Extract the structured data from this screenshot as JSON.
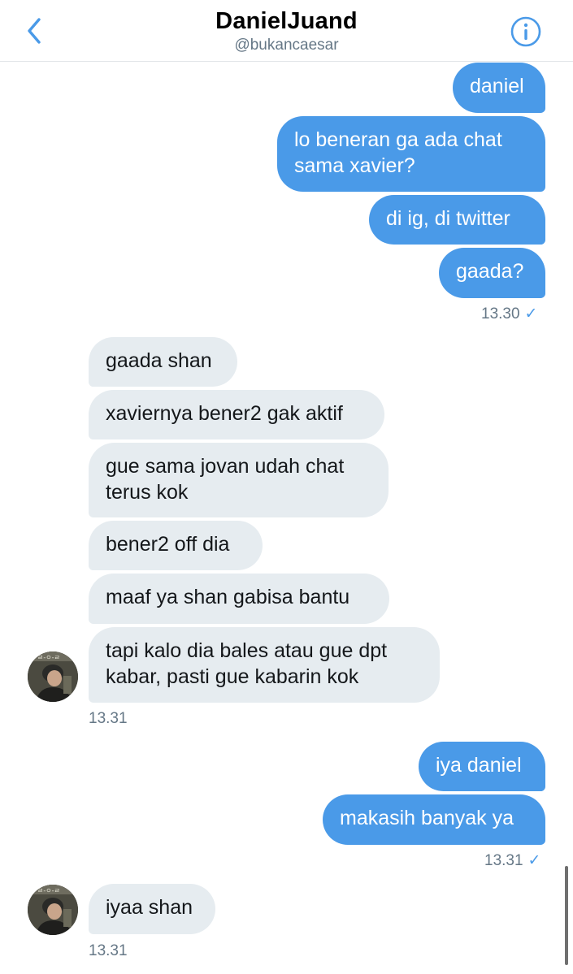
{
  "header": {
    "title": "DanielJuand",
    "handle": "@bukancaesar",
    "back_icon": "chevron-left-icon",
    "info_icon": "info-circle-icon"
  },
  "colors": {
    "accent": "#4a9ae8",
    "incoming_bubble": "#e6ecf0",
    "meta_text": "#657786"
  },
  "messages": {
    "m1": "daniel",
    "m2a": "lo beneran ga ada chat",
    "m2b": "sama xavier?",
    "m3": "di ig, di twitter",
    "m4": "gaada?",
    "t1": "13.30",
    "r1": "gaada shan",
    "r2": "xaviernya bener2 gak aktif",
    "r3a": "gue sama jovan udah chat",
    "r3b": "terus kok",
    "r4": "bener2 off dia",
    "r5": "maaf ya shan gabisa bantu",
    "r6a": "tapi kalo dia bales atau gue dpt",
    "r6b": "kabar, pasti gue kabarin kok",
    "t2": "13.31",
    "m5": "iya daniel",
    "m6": "makasih banyak ya",
    "t3": "13.31",
    "r7": "iyaa shan",
    "t4": "13.31"
  },
  "read_check": "✓"
}
